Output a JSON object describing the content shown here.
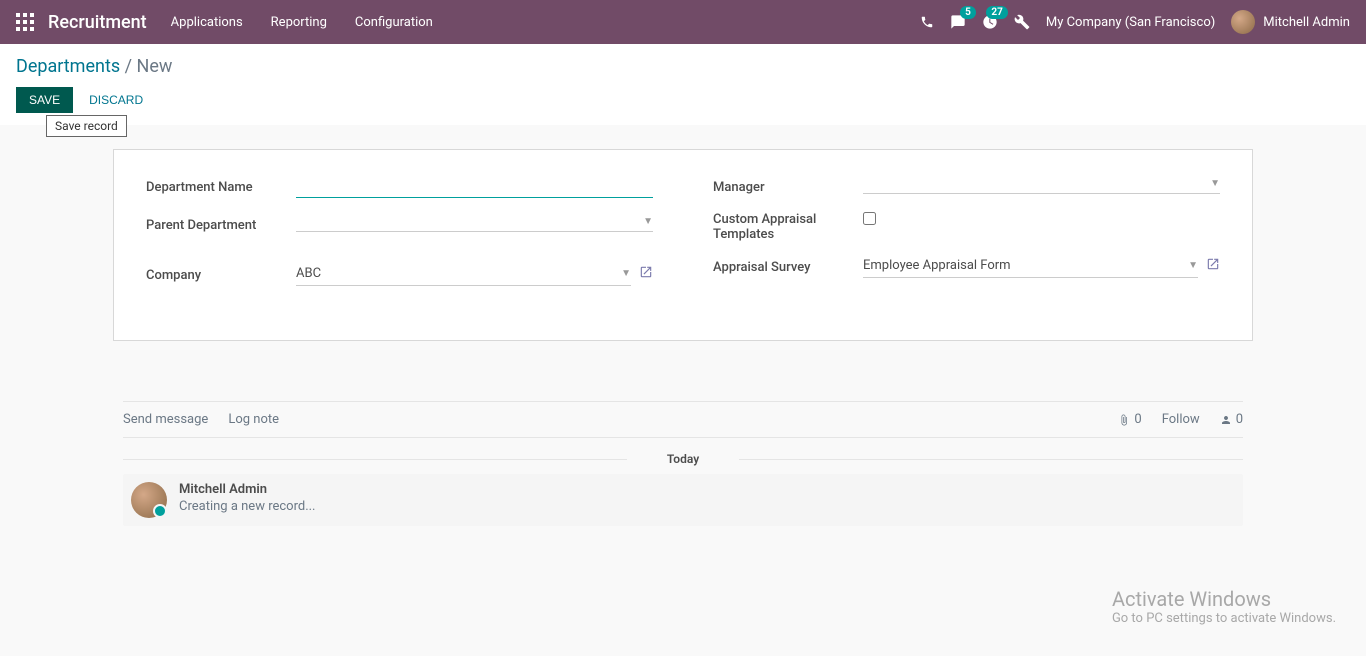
{
  "header": {
    "brand": "Recruitment",
    "menu": [
      "Applications",
      "Reporting",
      "Configuration"
    ],
    "messages_badge": "5",
    "activities_badge": "27",
    "company": "My Company (San Francisco)",
    "user": "Mitchell Admin"
  },
  "breadcrumb": {
    "root": "Departments",
    "current": "New"
  },
  "actions": {
    "save": "SAVE",
    "discard": "DISCARD",
    "save_tooltip": "Save record"
  },
  "form": {
    "left": {
      "department_name_label": "Department Name",
      "department_name_value": "",
      "parent_department_label": "Parent Department",
      "parent_department_value": "",
      "company_label": "Company",
      "company_value": "ABC"
    },
    "right": {
      "manager_label": "Manager",
      "manager_value": "",
      "custom_templates_label": "Custom Appraisal Templates",
      "appraisal_survey_label": "Appraisal Survey",
      "appraisal_survey_value": "Employee Appraisal Form"
    }
  },
  "chatter": {
    "send_message": "Send message",
    "log_note": "Log note",
    "attachments": "0",
    "follow": "Follow",
    "followers": "0",
    "date_label": "Today",
    "message": {
      "author": "Mitchell Admin",
      "body": "Creating a new record..."
    }
  },
  "watermark": {
    "title": "Activate Windows",
    "sub": "Go to PC settings to activate Windows."
  }
}
